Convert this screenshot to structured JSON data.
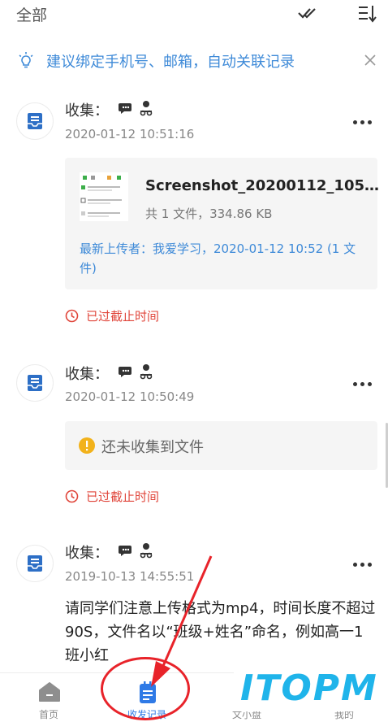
{
  "header": {
    "title": "全部"
  },
  "tip": {
    "text": "建议绑定手机号、邮箱，自动关联记录"
  },
  "records": [
    {
      "label": "收集：",
      "time": "2020-01-12 10:51:16",
      "file": {
        "name": "Screenshot_20200112_105…",
        "meta": "共 1 文件，334.86 KB",
        "uploader": "最新上传者：我爱学习，2020-01-12 10:52 (1 文件)"
      },
      "deadline": "已过截止时间"
    },
    {
      "label": "收集：",
      "time": "2020-01-12 10:50:49",
      "empty": "还未收集到文件",
      "deadline": "已过截止时间"
    },
    {
      "label": "收集：",
      "time": "2019-10-13 14:55:51",
      "description": "请同学们注意上传格式为mp4，时间长度不超过90S，文件名以“班级+姓名”命名，例如高一1班小红"
    }
  ],
  "tabs": [
    {
      "label": "首页"
    },
    {
      "label": "收发记录"
    },
    {
      "label": "文小盘"
    },
    {
      "label": "我的"
    }
  ],
  "watermark": "ITOPM",
  "colors": {
    "accent": "#3e8ad8",
    "deadline": "#e0453a",
    "annotation": "#e8232a"
  }
}
